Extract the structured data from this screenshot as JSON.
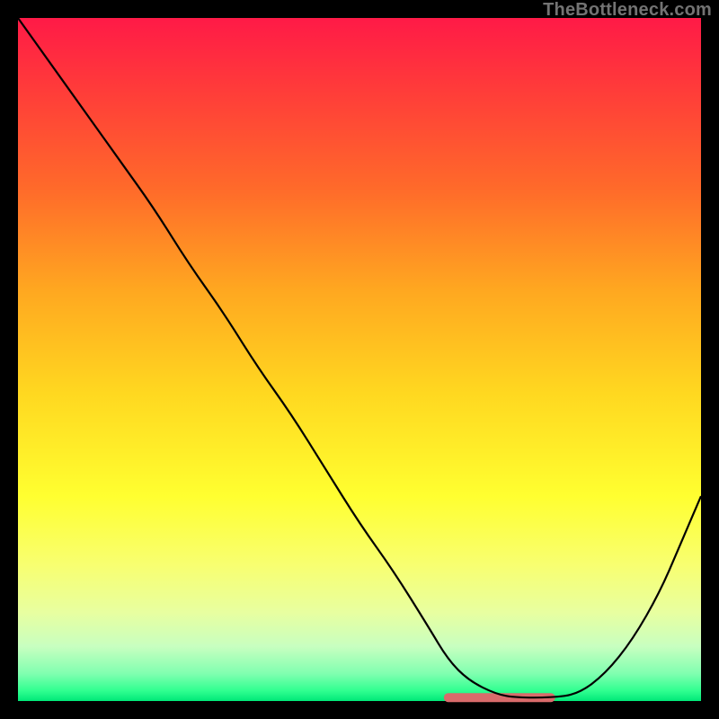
{
  "watermark": "TheBottleneck.com",
  "colors": {
    "page_bg": "#000000",
    "curve": "#000000",
    "accent_band": "#d96b6b",
    "watermark": "#737373"
  },
  "chart_data": {
    "type": "line",
    "title": "",
    "xlabel": "",
    "ylabel": "",
    "xlim": [
      0,
      100
    ],
    "ylim": [
      0,
      100
    ],
    "grid": false,
    "series": [
      {
        "name": "bottleneck-curve",
        "x": [
          0,
          5,
          10,
          15,
          20,
          25,
          30,
          35,
          40,
          45,
          50,
          55,
          60,
          63,
          66,
          70,
          73,
          78,
          82,
          86,
          90,
          94,
          97,
          100
        ],
        "values": [
          100,
          93,
          86,
          79,
          72,
          64,
          57,
          49,
          42,
          34,
          26,
          19,
          11,
          6,
          3,
          1,
          0.5,
          0.5,
          1,
          4,
          9,
          16,
          23,
          30
        ]
      }
    ],
    "annotations": [
      {
        "name": "optimal-band",
        "x_range": [
          63,
          78
        ],
        "y": 0.5,
        "color": "#d96b6b"
      }
    ],
    "gradient_stops": [
      {
        "pos": 0,
        "color": "#ff1a47"
      },
      {
        "pos": 0.25,
        "color": "#ff6a2a"
      },
      {
        "pos": 0.55,
        "color": "#ffd820"
      },
      {
        "pos": 0.8,
        "color": "#f8ff70"
      },
      {
        "pos": 0.96,
        "color": "#80ffb0"
      },
      {
        "pos": 1.0,
        "color": "#00e878"
      }
    ]
  }
}
